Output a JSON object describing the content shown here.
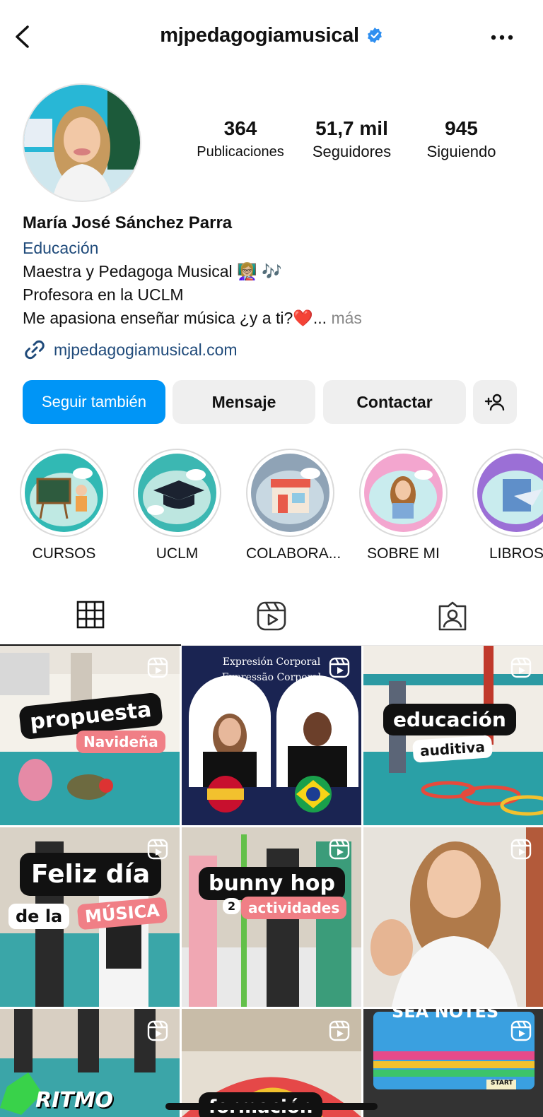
{
  "header": {
    "username": "mjpedagogiamusical",
    "back_icon": "chevron-left-icon",
    "more_icon": "more-horizontal-icon",
    "verified_icon": "verified-badge-icon"
  },
  "stats": {
    "posts": {
      "value": "364",
      "label": "Publicaciones"
    },
    "followers": {
      "value": "51,7 mil",
      "label": "Seguidores"
    },
    "following": {
      "value": "945",
      "label": "Siguiendo"
    }
  },
  "bio": {
    "name": "María José Sánchez Parra",
    "category": "Educación",
    "line1": "Maestra y Pedagoga Musical 👩🏼‍🏫 🎶",
    "line2": "Profesora en la UCLM",
    "line3": "Me apasiona enseñar música ¿y a ti?❤️...",
    "more": " más",
    "link": "mjpedagogiamusical.com"
  },
  "actions": {
    "follow": "Seguir también",
    "message": "Mensaje",
    "contact": "Contactar",
    "add_icon": "add-person-icon"
  },
  "highlights": [
    {
      "label": "CURSOS"
    },
    {
      "label": "UCLM"
    },
    {
      "label": "COLABORA..."
    },
    {
      "label": "SOBRE MI"
    },
    {
      "label": "LIBROS"
    }
  ],
  "tabs": [
    "grid-icon",
    "reels-icon",
    "tagged-icon"
  ],
  "posts": [
    {
      "title": "propuesta",
      "subtitle": "Navideña"
    },
    {
      "line1": "Expresión Corporal",
      "line2": "Expressão Corporal"
    },
    {
      "title": "educación",
      "subtitle": "auditiva"
    },
    {
      "title": "Feliz día",
      "subtitle1": "de la",
      "subtitle2": "MÚSICA"
    },
    {
      "title": "bunny hop",
      "num": "2",
      "subtitle": "actividades"
    },
    {},
    {
      "title": "RITMO"
    },
    {
      "title": "formación"
    },
    {
      "title": "SEA NOTES",
      "extra": "START"
    }
  ],
  "colors": {
    "accent": "#0095f6",
    "link": "#1f4a7a",
    "pink_label": "#f07f86",
    "navy": "#1a2452"
  }
}
